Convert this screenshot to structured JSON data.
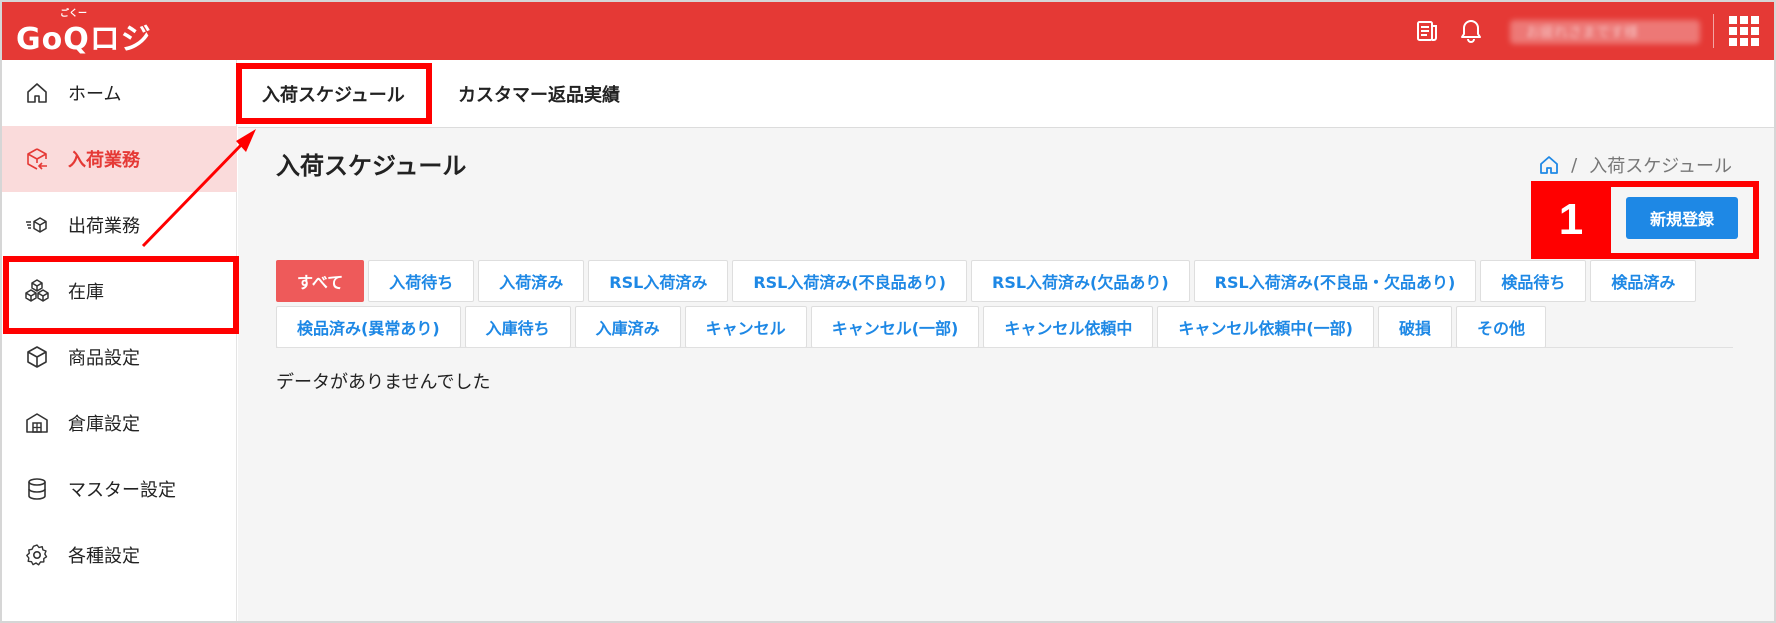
{
  "header": {
    "logo": "GoQロジ",
    "logo_ruby": "ごくー",
    "user_name": "お疲れさまです様",
    "accent_color": "#e53935"
  },
  "sidebar": {
    "items": [
      {
        "label": "ホーム",
        "icon": "home-icon"
      },
      {
        "label": "入荷業務",
        "icon": "box-inbound-icon",
        "active": true
      },
      {
        "label": "出荷業務",
        "icon": "box-outbound-icon"
      },
      {
        "label": "在庫",
        "icon": "stacked-boxes-icon"
      },
      {
        "label": "商品設定",
        "icon": "cube-icon"
      },
      {
        "label": "倉庫設定",
        "icon": "warehouse-icon"
      },
      {
        "label": "マスター設定",
        "icon": "database-icon"
      },
      {
        "label": "各種設定",
        "icon": "gear-icon"
      }
    ]
  },
  "tabs": [
    {
      "label": "入荷スケジュール",
      "active": true
    },
    {
      "label": "カスタマー返品実績"
    }
  ],
  "page": {
    "title": "入荷スケジュール",
    "breadcrumb_current": "入荷スケジュール",
    "breadcrumb_sep": "/",
    "new_button": "新規登録",
    "empty_message": "データがありませんでした"
  },
  "filters": {
    "row1": [
      "すべて",
      "入荷待ち",
      "入荷済み",
      "RSL入荷済み",
      "RSL入荷済み(不良品あり)",
      "RSL入荷済み(欠品あり)",
      "RSL入荷済み(不良品・欠品あり)",
      "検品待ち",
      "検品済み"
    ],
    "row2": [
      "検品済み(異常あり)",
      "入庫待ち",
      "入庫済み",
      "キャンセル",
      "キャンセル(一部)",
      "キャンセル依頼中",
      "キャンセル依頼中(一部)",
      "破損",
      "その他"
    ]
  },
  "annotation": {
    "step_number": "1",
    "color": "#ff0000"
  }
}
